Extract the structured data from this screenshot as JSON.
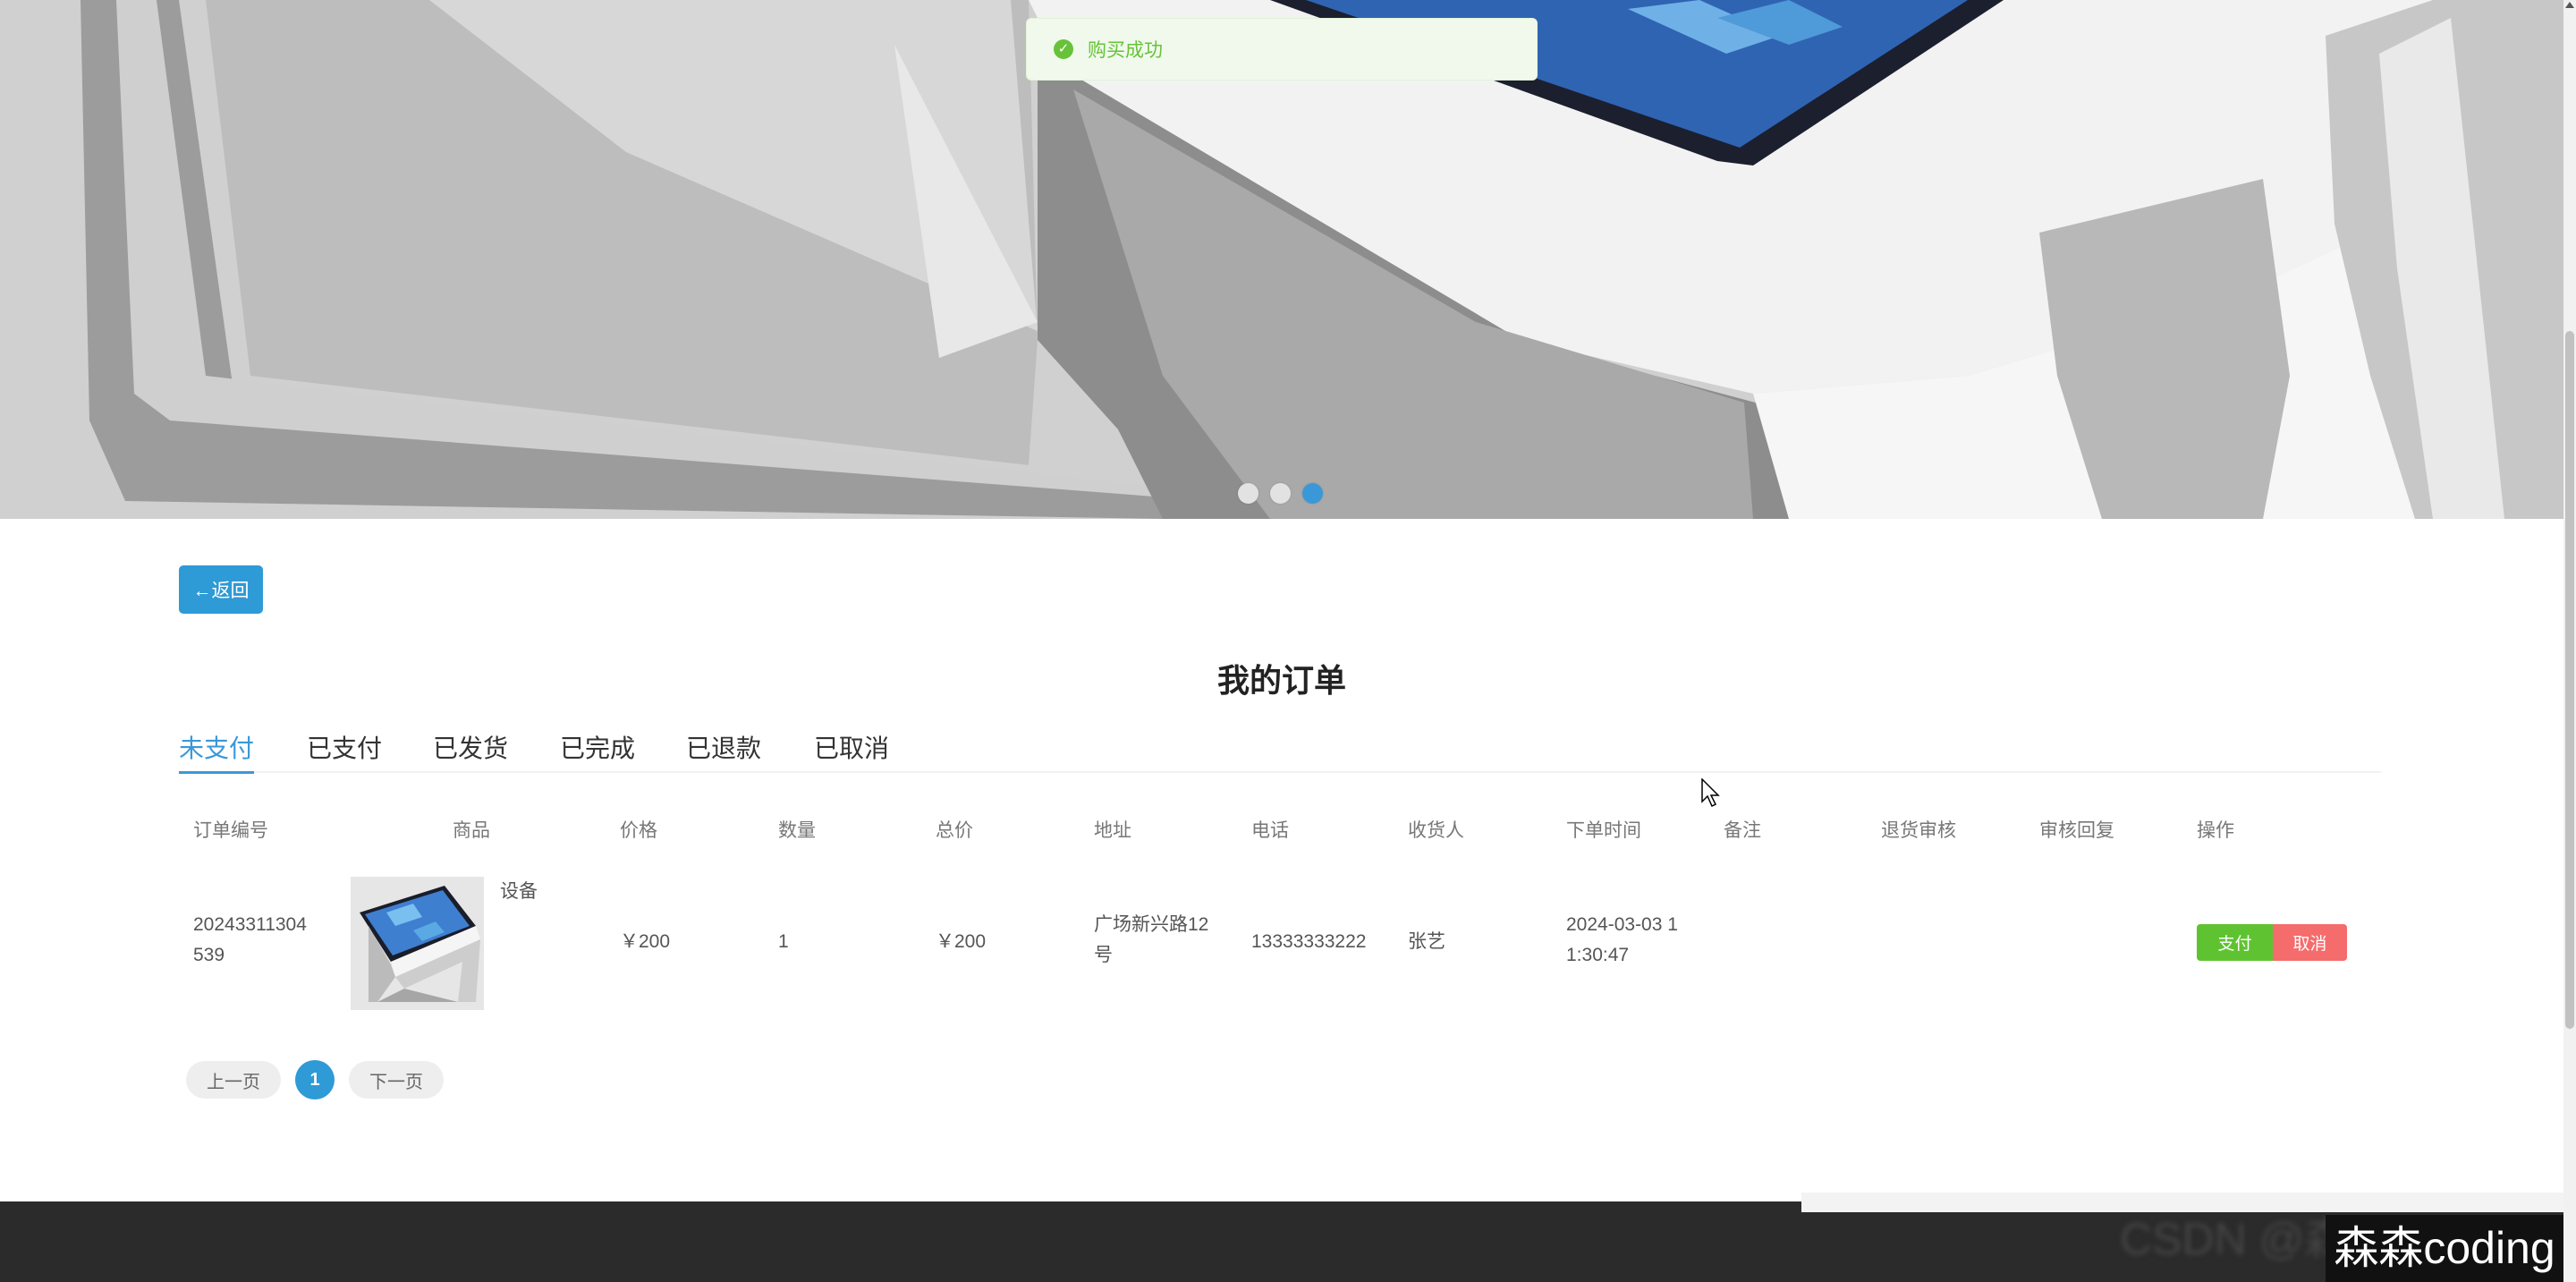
{
  "toast": {
    "icon": "success-check-icon",
    "message": "购买成功"
  },
  "banner": {
    "slides": 3,
    "active_index": 2
  },
  "back_button": "←返回",
  "page_title": "我的订单",
  "tabs": [
    "未支付",
    "已支付",
    "已发货",
    "已完成",
    "已退款",
    "已取消"
  ],
  "active_tab": 0,
  "table": {
    "headers": [
      "订单编号",
      "商品",
      "价格",
      "数量",
      "总价",
      "地址",
      "电话",
      "收货人",
      "下单时间",
      "备注",
      "退货审核",
      "审核回复",
      "操作"
    ],
    "row": {
      "order_no_line1": "20243311304",
      "order_no_line2": "539",
      "product_name": "设备",
      "price": "￥200",
      "quantity": "1",
      "total": "￥200",
      "address_line1": "广场新兴路12",
      "address_line2": "号",
      "phone": "13333333222",
      "receiver": "张艺",
      "time_line1": "2024-03-03 1",
      "time_line2": "1:30:47",
      "remark": "",
      "return_review": "",
      "review_reply": "",
      "pay_label": "支付",
      "cancel_label": "取消"
    }
  },
  "pagination": {
    "prev": "上一页",
    "current": "1",
    "next": "下一页"
  },
  "watermark": "森森coding",
  "footer_blur_text": "CSDN @森"
}
